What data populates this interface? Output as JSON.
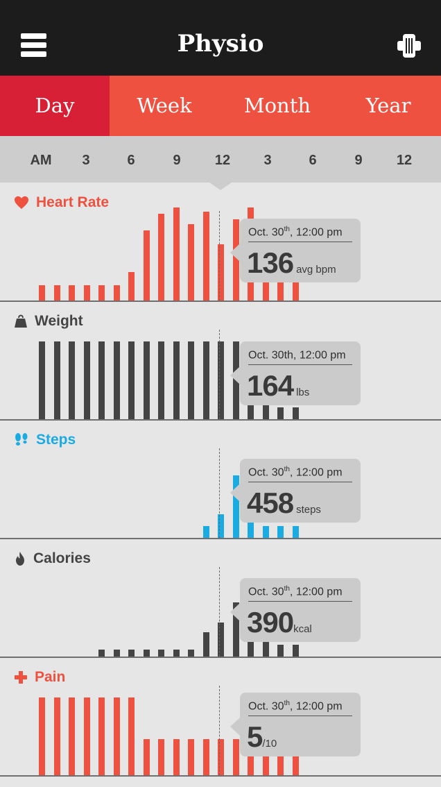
{
  "app": {
    "title": "Physio",
    "menu_icon": "hamburger-menu-icon",
    "action_icon": "bandage-icon"
  },
  "tabs": [
    {
      "label": "Day",
      "active": true
    },
    {
      "label": "Week",
      "active": false
    },
    {
      "label": "Month",
      "active": false
    },
    {
      "label": "Year",
      "active": false
    }
  ],
  "timeline": {
    "ticks": [
      "AM",
      "3",
      "6",
      "9",
      "12",
      "3",
      "6",
      "9",
      "12"
    ]
  },
  "colors": {
    "heart": "#ee5140",
    "weight": "#444444",
    "steps": "#1aabe3",
    "calories": "#444444",
    "pain": "#ee5140",
    "active_tab": "#d71f35",
    "tab_bar": "#ee5140",
    "topbar": "#1c1c1c"
  },
  "sections": [
    {
      "key": "heart",
      "label": "Heart Rate",
      "icon": "heart-icon",
      "color": "#ee5140",
      "tooltip": {
        "date": "Oct. 30",
        "date_sup": "th",
        "date_time": ", 12:00 pm",
        "value": "136",
        "unit": "avg bpm"
      },
      "series": [
        0.13,
        0.13,
        0.13,
        0.13,
        0.13,
        0.13,
        0.24,
        0.6,
        0.74,
        0.79,
        0.65,
        0.76,
        0.48,
        0.69,
        0.79,
        0.48,
        0.33,
        0.33
      ]
    },
    {
      "key": "weight",
      "label": "Weight",
      "icon": "weight-icon",
      "color": "#444444",
      "tooltip": {
        "date": "Oct. 30th, 12:00 pm",
        "date_sup": "",
        "date_time": "",
        "value": "164",
        "unit": "lbs"
      },
      "series": [
        0.66,
        0.66,
        0.66,
        0.66,
        0.66,
        0.66,
        0.66,
        0.66,
        0.66,
        0.66,
        0.66,
        0.66,
        0.66,
        0.66,
        0.66,
        0.66,
        0.1,
        0.1
      ]
    },
    {
      "key": "steps",
      "label": "Steps",
      "icon": "footprints-icon",
      "color": "#1aabe3",
      "tooltip": {
        "date": "Oct. 30",
        "date_sup": "th",
        "date_time": ", 12:00 pm",
        "value": "458",
        "unit": "steps"
      },
      "series": [
        0,
        0,
        0,
        0,
        0,
        0,
        0,
        0,
        0,
        0,
        0,
        0.1,
        0.2,
        0.53,
        0.45,
        0.1,
        0.1,
        0.1
      ]
    },
    {
      "key": "calories",
      "label": "Calories",
      "icon": "flame-icon",
      "color": "#444444",
      "tooltip": {
        "date": "Oct. 30",
        "date_sup": "th",
        "date_time": ", 12:00 pm",
        "value": "390",
        "unit": "kcal"
      },
      "series": [
        0,
        0,
        0,
        0,
        0.06,
        0.06,
        0.06,
        0.06,
        0.06,
        0.06,
        0.06,
        0.21,
        0.29,
        0.46,
        0.46,
        0.46,
        0.1,
        0.1
      ]
    },
    {
      "key": "pain",
      "label": "Pain",
      "icon": "medical-cross-icon",
      "color": "#ee5140",
      "tooltip": {
        "date": "Oct. 30",
        "date_sup": "th",
        "date_time": ", 12:00 pm",
        "value": "5",
        "unit": "/10"
      },
      "series": [
        0.66,
        0.66,
        0.66,
        0.66,
        0.66,
        0.66,
        0.66,
        0.31,
        0.31,
        0.31,
        0.31,
        0.31,
        0.31,
        0.31,
        0.51,
        0.51,
        0.16,
        0.16
      ]
    }
  ]
}
